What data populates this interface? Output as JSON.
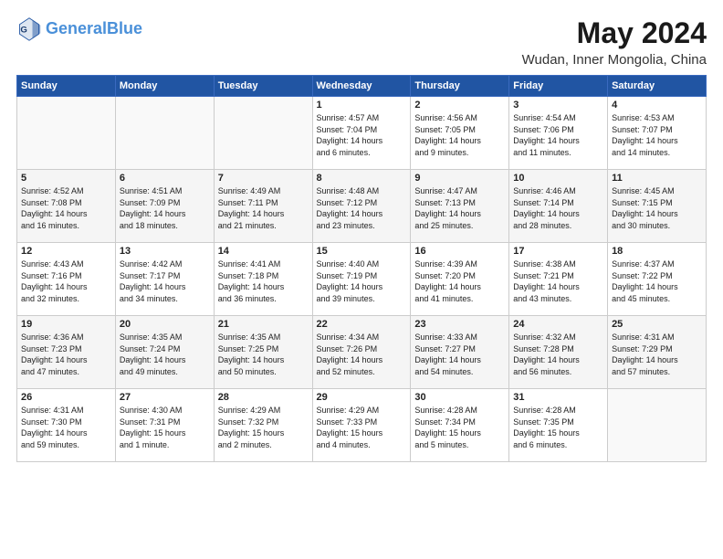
{
  "header": {
    "logo_line1": "General",
    "logo_line2": "Blue",
    "month": "May 2024",
    "location": "Wudan, Inner Mongolia, China"
  },
  "weekdays": [
    "Sunday",
    "Monday",
    "Tuesday",
    "Wednesday",
    "Thursday",
    "Friday",
    "Saturday"
  ],
  "weeks": [
    [
      {
        "day": "",
        "content": ""
      },
      {
        "day": "",
        "content": ""
      },
      {
        "day": "",
        "content": ""
      },
      {
        "day": "1",
        "content": "Sunrise: 4:57 AM\nSunset: 7:04 PM\nDaylight: 14 hours\nand 6 minutes."
      },
      {
        "day": "2",
        "content": "Sunrise: 4:56 AM\nSunset: 7:05 PM\nDaylight: 14 hours\nand 9 minutes."
      },
      {
        "day": "3",
        "content": "Sunrise: 4:54 AM\nSunset: 7:06 PM\nDaylight: 14 hours\nand 11 minutes."
      },
      {
        "day": "4",
        "content": "Sunrise: 4:53 AM\nSunset: 7:07 PM\nDaylight: 14 hours\nand 14 minutes."
      }
    ],
    [
      {
        "day": "5",
        "content": "Sunrise: 4:52 AM\nSunset: 7:08 PM\nDaylight: 14 hours\nand 16 minutes."
      },
      {
        "day": "6",
        "content": "Sunrise: 4:51 AM\nSunset: 7:09 PM\nDaylight: 14 hours\nand 18 minutes."
      },
      {
        "day": "7",
        "content": "Sunrise: 4:49 AM\nSunset: 7:11 PM\nDaylight: 14 hours\nand 21 minutes."
      },
      {
        "day": "8",
        "content": "Sunrise: 4:48 AM\nSunset: 7:12 PM\nDaylight: 14 hours\nand 23 minutes."
      },
      {
        "day": "9",
        "content": "Sunrise: 4:47 AM\nSunset: 7:13 PM\nDaylight: 14 hours\nand 25 minutes."
      },
      {
        "day": "10",
        "content": "Sunrise: 4:46 AM\nSunset: 7:14 PM\nDaylight: 14 hours\nand 28 minutes."
      },
      {
        "day": "11",
        "content": "Sunrise: 4:45 AM\nSunset: 7:15 PM\nDaylight: 14 hours\nand 30 minutes."
      }
    ],
    [
      {
        "day": "12",
        "content": "Sunrise: 4:43 AM\nSunset: 7:16 PM\nDaylight: 14 hours\nand 32 minutes."
      },
      {
        "day": "13",
        "content": "Sunrise: 4:42 AM\nSunset: 7:17 PM\nDaylight: 14 hours\nand 34 minutes."
      },
      {
        "day": "14",
        "content": "Sunrise: 4:41 AM\nSunset: 7:18 PM\nDaylight: 14 hours\nand 36 minutes."
      },
      {
        "day": "15",
        "content": "Sunrise: 4:40 AM\nSunset: 7:19 PM\nDaylight: 14 hours\nand 39 minutes."
      },
      {
        "day": "16",
        "content": "Sunrise: 4:39 AM\nSunset: 7:20 PM\nDaylight: 14 hours\nand 41 minutes."
      },
      {
        "day": "17",
        "content": "Sunrise: 4:38 AM\nSunset: 7:21 PM\nDaylight: 14 hours\nand 43 minutes."
      },
      {
        "day": "18",
        "content": "Sunrise: 4:37 AM\nSunset: 7:22 PM\nDaylight: 14 hours\nand 45 minutes."
      }
    ],
    [
      {
        "day": "19",
        "content": "Sunrise: 4:36 AM\nSunset: 7:23 PM\nDaylight: 14 hours\nand 47 minutes."
      },
      {
        "day": "20",
        "content": "Sunrise: 4:35 AM\nSunset: 7:24 PM\nDaylight: 14 hours\nand 49 minutes."
      },
      {
        "day": "21",
        "content": "Sunrise: 4:35 AM\nSunset: 7:25 PM\nDaylight: 14 hours\nand 50 minutes."
      },
      {
        "day": "22",
        "content": "Sunrise: 4:34 AM\nSunset: 7:26 PM\nDaylight: 14 hours\nand 52 minutes."
      },
      {
        "day": "23",
        "content": "Sunrise: 4:33 AM\nSunset: 7:27 PM\nDaylight: 14 hours\nand 54 minutes."
      },
      {
        "day": "24",
        "content": "Sunrise: 4:32 AM\nSunset: 7:28 PM\nDaylight: 14 hours\nand 56 minutes."
      },
      {
        "day": "25",
        "content": "Sunrise: 4:31 AM\nSunset: 7:29 PM\nDaylight: 14 hours\nand 57 minutes."
      }
    ],
    [
      {
        "day": "26",
        "content": "Sunrise: 4:31 AM\nSunset: 7:30 PM\nDaylight: 14 hours\nand 59 minutes."
      },
      {
        "day": "27",
        "content": "Sunrise: 4:30 AM\nSunset: 7:31 PM\nDaylight: 15 hours\nand 1 minute."
      },
      {
        "day": "28",
        "content": "Sunrise: 4:29 AM\nSunset: 7:32 PM\nDaylight: 15 hours\nand 2 minutes."
      },
      {
        "day": "29",
        "content": "Sunrise: 4:29 AM\nSunset: 7:33 PM\nDaylight: 15 hours\nand 4 minutes."
      },
      {
        "day": "30",
        "content": "Sunrise: 4:28 AM\nSunset: 7:34 PM\nDaylight: 15 hours\nand 5 minutes."
      },
      {
        "day": "31",
        "content": "Sunrise: 4:28 AM\nSunset: 7:35 PM\nDaylight: 15 hours\nand 6 minutes."
      },
      {
        "day": "",
        "content": ""
      }
    ]
  ]
}
